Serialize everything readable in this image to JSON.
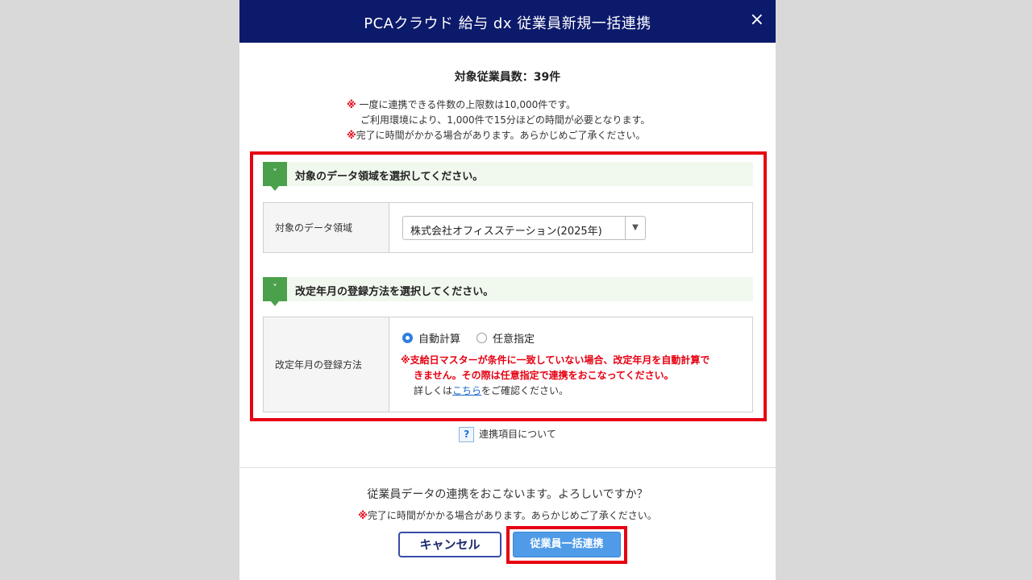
{
  "dialog": {
    "title": "PCAクラウド 給与 dx 従業員新規一括連携",
    "close_icon": "×",
    "count_text": "対象従業員数：39件",
    "notes": {
      "mark": "※",
      "line1": "一度に連携できる件数の上限数は10,000件です。",
      "line2": "ご利用環境により、1,000件で15分ほどの時間が必要となります。",
      "line3": "完了に時間がかかる場合があります。あらかじめご了承ください。"
    }
  },
  "section1": {
    "badge_icon": "˅",
    "heading": "対象のデータ領域を選択してください。",
    "field_label": "対象のデータ領域",
    "select_value": "株式会社オフィスステーション(2025年)",
    "select_arrow": "▼"
  },
  "section2": {
    "badge_icon": "˅",
    "heading": "改定年月の登録方法を選択してください。",
    "field_label": "改定年月の登録方法",
    "radio_auto": "自動計算",
    "radio_manual": "任意指定",
    "selected": "自動計算",
    "warn_mark": "※",
    "warn_line1": "支給日マスターが条件に一致していない場合、改定年月を自動計算で",
    "warn_line2": "きません。その際は任意指定で連携をおこなってください。",
    "detail_prefix": "詳しくは",
    "detail_link": "こちら",
    "detail_suffix": "をご確認ください。"
  },
  "help": {
    "icon": "?",
    "label": "連携項目について"
  },
  "footer": {
    "confirm_text": "従業員データの連携をおこないます。よろしいですか？",
    "note_mark": "※",
    "note_text": "完了に時間がかかる場合があります。あらかじめご了承ください。",
    "cancel_label": "キャンセル",
    "submit_label": "従業員一括連携"
  },
  "colors": {
    "titlebar": "#0c1a6b",
    "accent_green": "#4aa04b",
    "highlight_red": "#e60012",
    "primary_button": "#4f9be8"
  }
}
